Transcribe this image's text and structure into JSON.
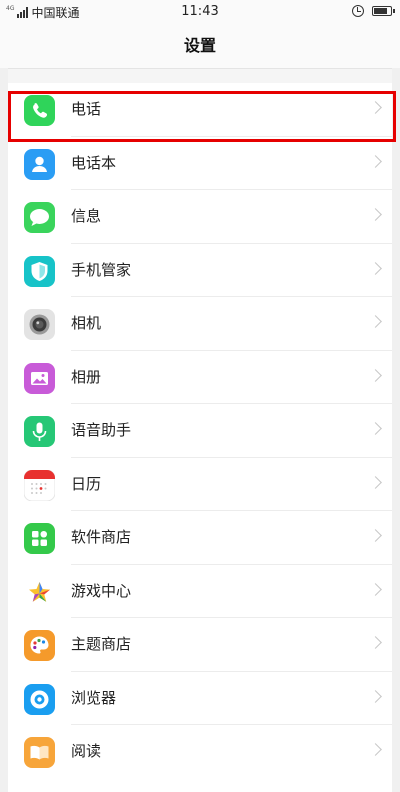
{
  "status_bar": {
    "network": "4G",
    "carrier": "中国联通",
    "time": "11:43",
    "battery_level": 0.8
  },
  "header": {
    "title": "设置"
  },
  "items": [
    {
      "label": "电话",
      "icon": "phone-icon",
      "color": "#2fd45a"
    },
    {
      "label": "电话本",
      "icon": "contacts-icon",
      "color": "#2a9df4"
    },
    {
      "label": "信息",
      "icon": "message-icon",
      "color": "#3ad45c"
    },
    {
      "label": "手机管家",
      "icon": "shield-icon",
      "color": "#17c3c8"
    },
    {
      "label": "相机",
      "icon": "camera-icon",
      "color": "#d9d9d9"
    },
    {
      "label": "相册",
      "icon": "gallery-icon",
      "color": "#c85bd8"
    },
    {
      "label": "语音助手",
      "icon": "microphone-icon",
      "color": "#26c776"
    },
    {
      "label": "日历",
      "icon": "calendar-icon",
      "color": "#ffffff"
    },
    {
      "label": "软件商店",
      "icon": "app-store-icon",
      "color": "#34c94a"
    },
    {
      "label": "游戏中心",
      "icon": "star-icon",
      "color": "#ffffff"
    },
    {
      "label": "主题商店",
      "icon": "palette-icon",
      "color": "#f59a2b"
    },
    {
      "label": "浏览器",
      "icon": "browser-icon",
      "color": "#1a9ef0"
    },
    {
      "label": "阅读",
      "icon": "book-icon",
      "color": "#f7a53a"
    }
  ],
  "highlight": {
    "color": "#e60000",
    "target": "电话"
  }
}
